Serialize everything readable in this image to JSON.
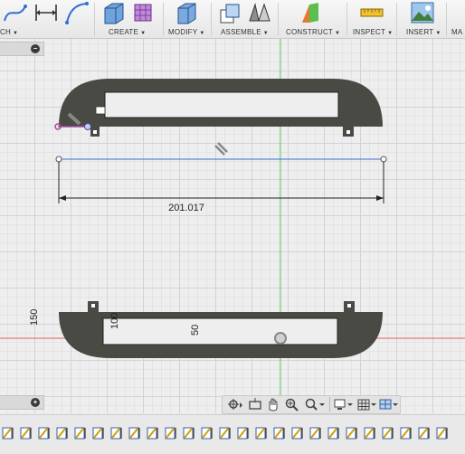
{
  "toolbar": {
    "groups": [
      {
        "label": "CH",
        "has_menu": true
      },
      {
        "label": "CREATE",
        "has_menu": true
      },
      {
        "label": "MODIFY",
        "has_menu": true
      },
      {
        "label": "ASSEMBLE",
        "has_menu": true
      },
      {
        "label": "CONSTRUCT",
        "has_menu": true
      },
      {
        "label": "INSPECT",
        "has_menu": true
      },
      {
        "label": "INSERT",
        "has_menu": true
      },
      {
        "label": "MA",
        "has_menu": false
      }
    ],
    "icons": [
      "spline-icon",
      "dimension-icon",
      "arc-icon",
      "extrude-icon",
      "form-icon",
      "press-pull-icon",
      "new-component-icon",
      "joint-icon",
      "offset-plane-icon",
      "measure-icon",
      "insert-canvas-icon"
    ]
  },
  "canvas": {
    "dimensions": {
      "horizontal": "201.017",
      "vertical_left": "150",
      "inner_100": "100",
      "inner_50": "50"
    },
    "axis_colors": {
      "green": "#5cc85c",
      "red": "#e06060",
      "sketch_line": "#3a6fd8",
      "body": "#4a4a44"
    },
    "panel_toggles": {
      "top_symbol": "−",
      "bottom_symbol": "+"
    }
  },
  "navbar": {
    "buttons": [
      "orbit-icon",
      "look-at-icon",
      "pan-icon",
      "zoom-window-icon",
      "zoom-icon",
      "display-settings-icon",
      "grid-settings-icon",
      "viewports-icon"
    ]
  },
  "timeline": {
    "item_count": 25,
    "item_icon": "sketch-feature-icon"
  }
}
